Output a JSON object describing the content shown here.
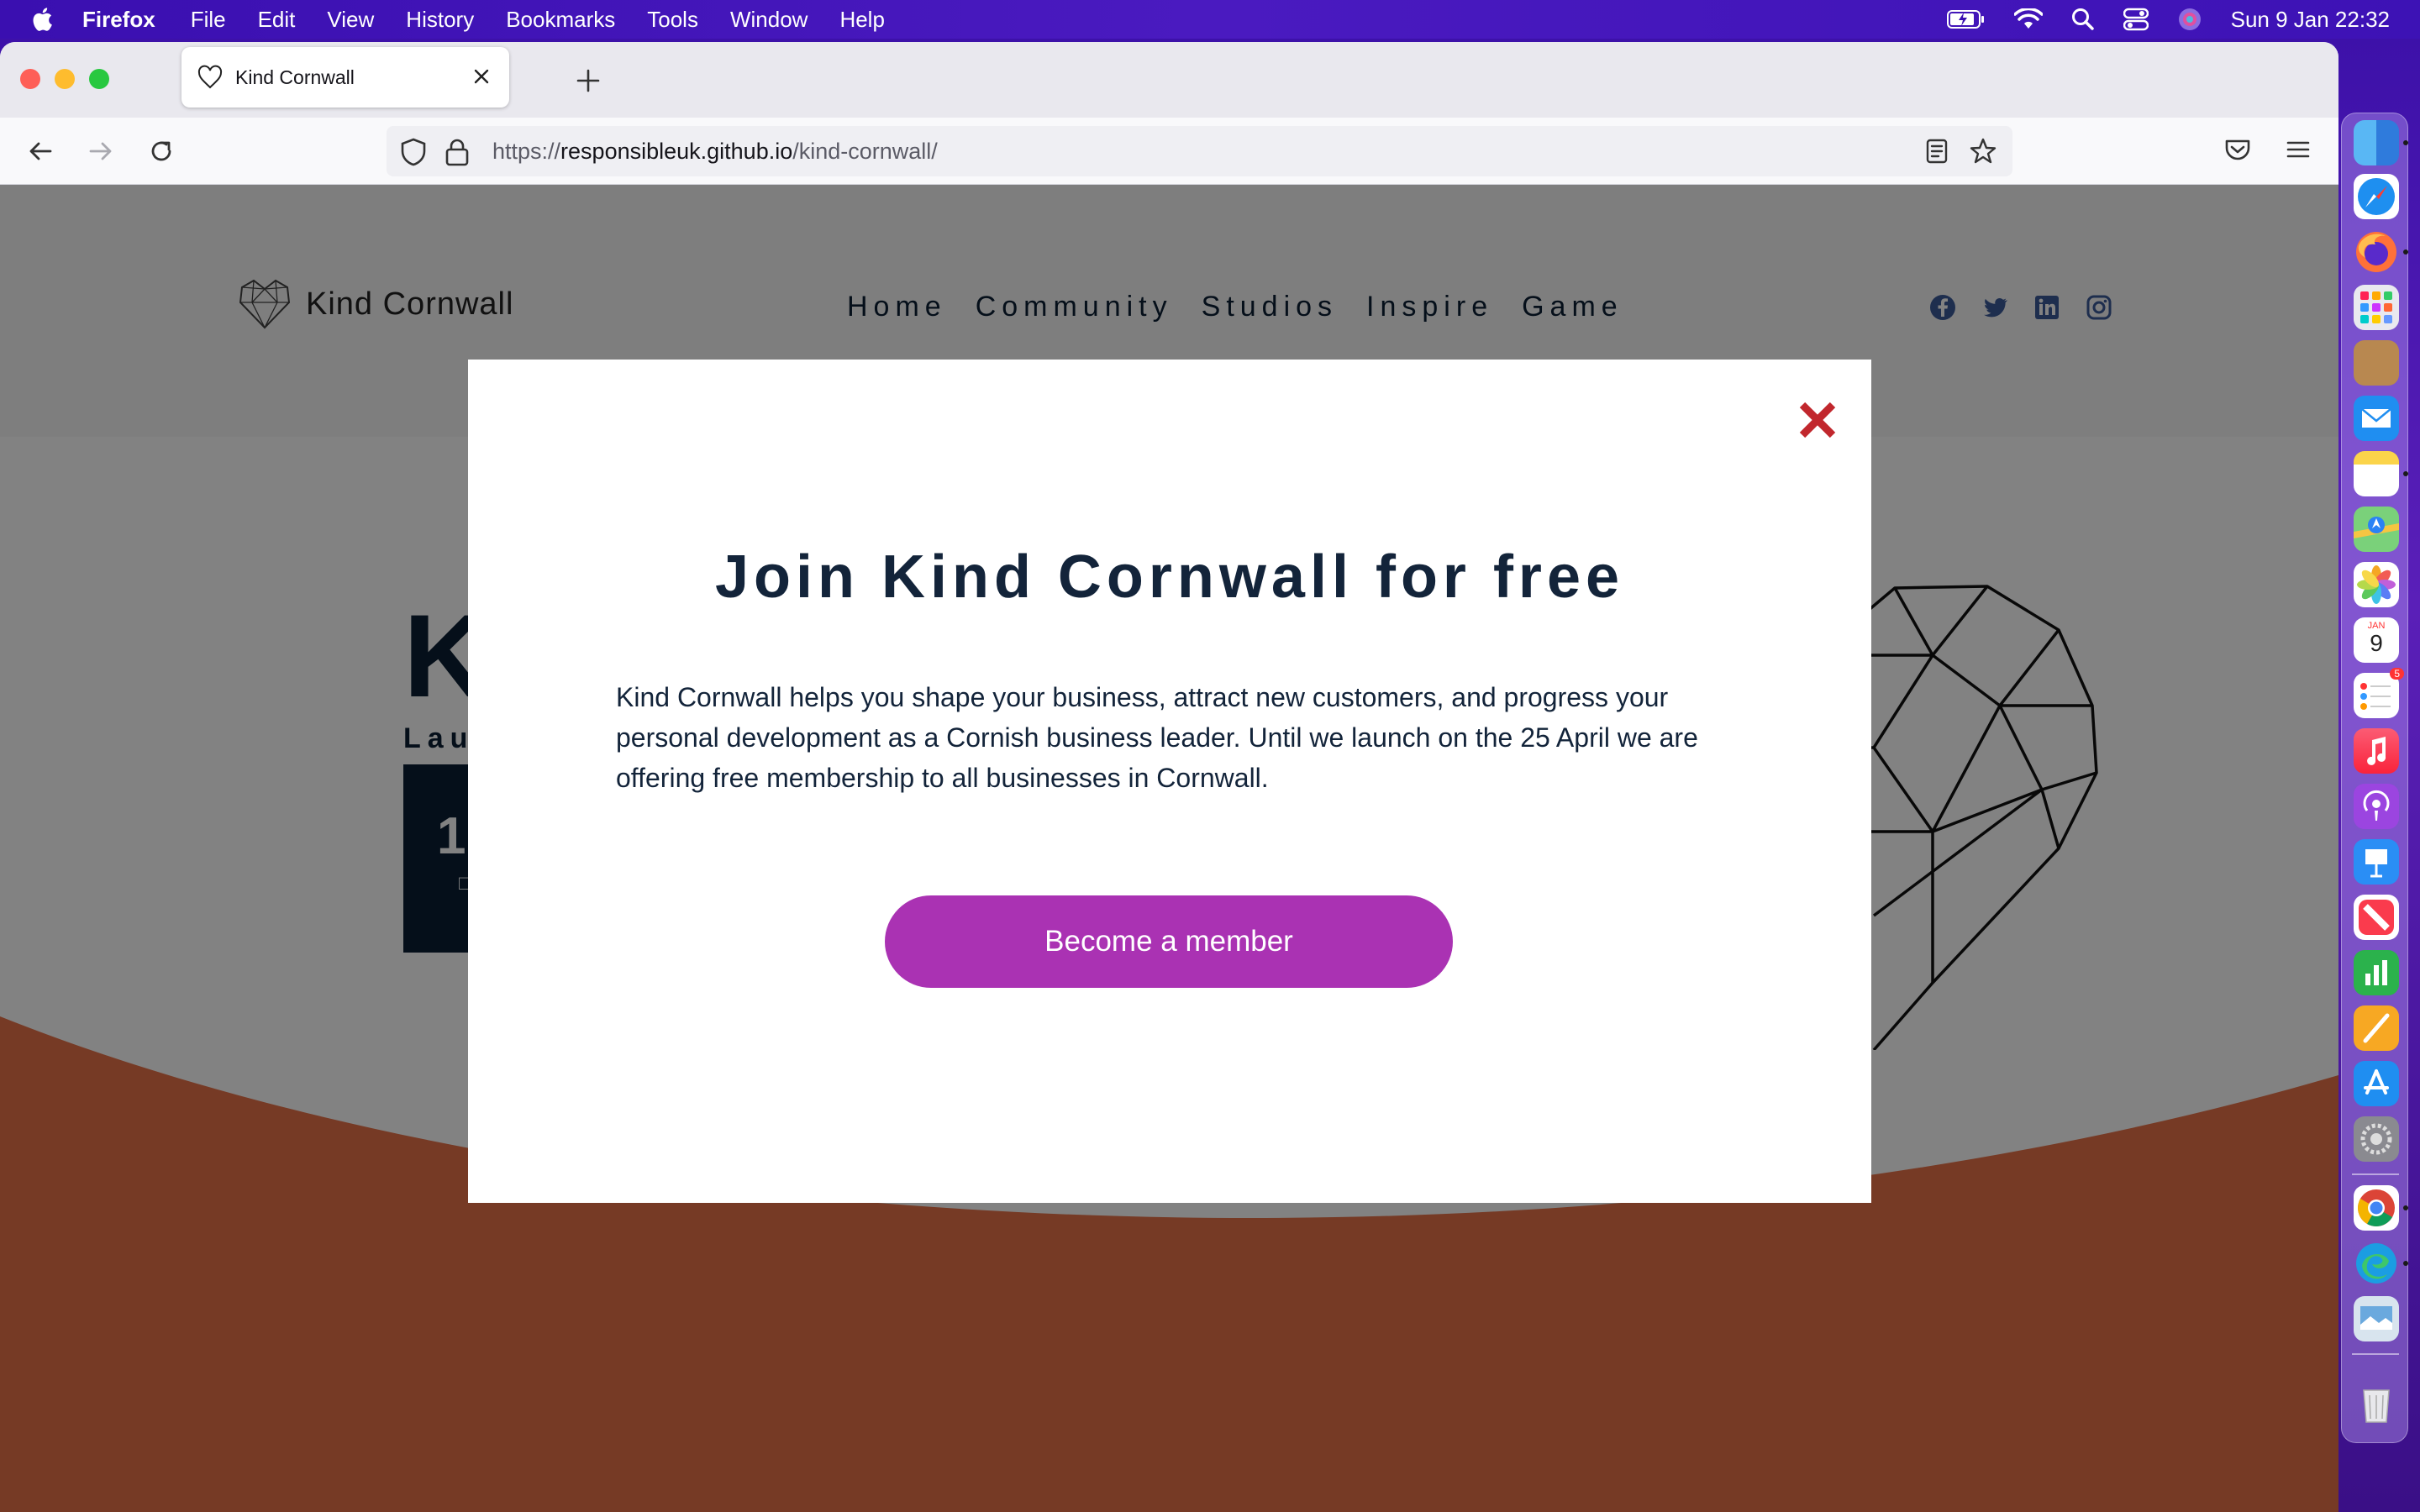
{
  "menubar": {
    "app_name": "Firefox",
    "items": [
      "File",
      "Edit",
      "View",
      "History",
      "Bookmarks",
      "Tools",
      "Window",
      "Help"
    ],
    "clock": "Sun 9 Jan  22:32"
  },
  "browser": {
    "tab_title": "Kind Cornwall",
    "url_scheme": "https://",
    "url_domain": "responsibleuk.github.io",
    "url_path": "/kind-cornwall/"
  },
  "site": {
    "logo_text": "Kind Cornwall",
    "nav": [
      "Home",
      "Community",
      "Studios",
      "Inspire",
      "Game"
    ],
    "hero_title": "K",
    "hero_subtitle": "Lau",
    "countdown_number": "1"
  },
  "modal": {
    "title": "Join Kind Cornwall for free",
    "body": "Kind Cornwall helps you shape your business, attract new customers, and progress your personal development as a Cornish business leader. Until we launch on the 25 April we are offering free membership to all businesses in Cornwall.",
    "button": "Become a member"
  },
  "dock": {
    "apps": [
      "finder-icon",
      "safari-icon",
      "firefox-icon",
      "launchpad-icon",
      "contacts-icon",
      "mail-icon",
      "notes-icon",
      "maps-icon",
      "photos-icon",
      "calendar-icon",
      "reminders-icon",
      "music-icon",
      "podcasts-icon",
      "keynote-icon",
      "news-icon",
      "numbers-icon",
      "pages-icon",
      "app-store-icon",
      "system-preferences-icon",
      "chrome-icon",
      "edge-icon",
      "preview-icon",
      "trash-icon"
    ],
    "calendar_month": "JAN",
    "calendar_day": "9",
    "reminders_badge": "5"
  },
  "colors": {
    "accent_button": "#aa32b3",
    "modal_title": "#13243a",
    "close_x": "#c1272d",
    "orange_wave": "#e8734a"
  }
}
